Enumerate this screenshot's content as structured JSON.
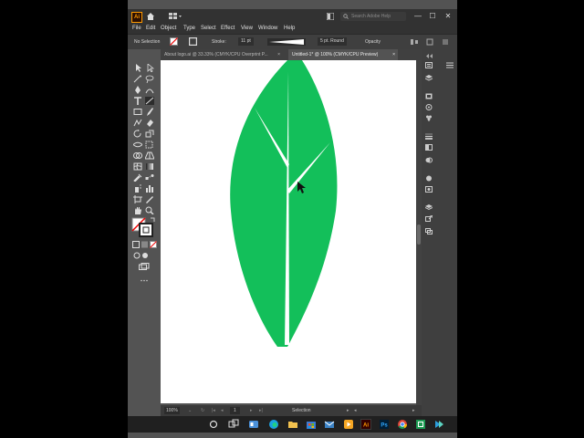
{
  "app": {
    "logo_text": "Ai",
    "search_placeholder": "Search Adobe Help",
    "window_controls": {
      "minimize": "—",
      "restore": "☐",
      "close": "✕"
    }
  },
  "menu": {
    "items": [
      "File",
      "Edit",
      "Object",
      "Type",
      "Select",
      "Effect",
      "View",
      "Window",
      "Help"
    ]
  },
  "control_bar": {
    "selection": "No Selection",
    "stroke_label": "Stroke:",
    "stroke_value": "11 pt",
    "brush": "5 pt. Round",
    "opacity_label": "Opacity"
  },
  "tabs": [
    {
      "label": "About logo.ai @ 33.33% (CMYK/CPU Overprint P...",
      "close": "×",
      "active": false
    },
    {
      "label": "Untitled-1* @ 100% (CMYK/CPU Preview)",
      "close": "×",
      "active": true
    }
  ],
  "status_bar": {
    "zoom": "100%",
    "artboard": "1",
    "tool": "Selection"
  },
  "colors": {
    "leaf": "#13bf5a",
    "ui_bg": "#535353",
    "panel": "#3f3f3f",
    "titlebar": "#323232"
  },
  "icons": {
    "toolbar": [
      "selection-tool",
      "direct-selection-tool",
      "magic-wand-tool",
      "lasso-tool",
      "pen-tool",
      "curvature-tool",
      "type-tool",
      "line-tool",
      "rectangle-tool",
      "paintbrush-tool",
      "shaper-tool",
      "pencil-tool",
      "eraser-tool",
      "rotate-tool",
      "scale-tool",
      "width-tool",
      "free-transform-tool",
      "shape-builder-tool",
      "perspective-tool",
      "mesh-tool",
      "gradient-tool",
      "eyedropper-tool",
      "blend-tool",
      "symbol-sprayer-tool",
      "graph-tool",
      "artboard-tool",
      "slice-tool",
      "hand-tool",
      "zoom-tool"
    ],
    "right_panel": [
      "properties-icon",
      "layers-icon",
      "libraries-icon",
      "color-icon",
      "color-guide-icon",
      "swatches-icon",
      "brushes-icon",
      "symbols-icon",
      "stroke-icon",
      "gradient-icon",
      "transparency-icon",
      "appearance-icon",
      "graphic-styles-icon",
      "layers-stack-icon",
      "export-icon",
      "artboards-icon"
    ],
    "taskbar": [
      "search-icon",
      "task-view-icon",
      "widgets-icon",
      "edge-icon",
      "explorer-icon",
      "store-icon",
      "mail-icon",
      "illustrator-icon",
      "photoshop-icon",
      "chrome-icon",
      "excel-icon",
      "terminal-icon"
    ]
  }
}
